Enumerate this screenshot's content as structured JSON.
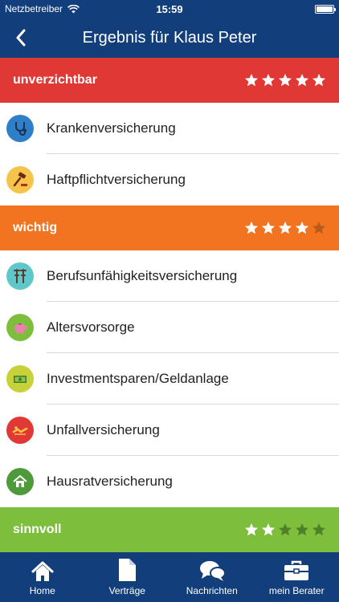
{
  "status_bar": {
    "carrier": "Netzbetreiber",
    "time": "15:59"
  },
  "nav": {
    "title": "Ergebnis für Klaus Peter"
  },
  "colors": {
    "nav": "#123e7c",
    "unverzichtbar": "#e03835",
    "wichtig": "#f27420",
    "sinnvoll": "#7dbf3c",
    "star_filled": "#ffffff"
  },
  "sections": [
    {
      "title": "unverzichtbar",
      "rating": 5,
      "items": [
        {
          "label": "Krankenversicherung",
          "icon": "stethoscope-icon"
        },
        {
          "label": "Haftpflichtversicherung",
          "icon": "gavel-icon"
        }
      ]
    },
    {
      "title": "wichtig",
      "rating": 4,
      "items": [
        {
          "label": "Berufsunfähigkeitsversicherung",
          "icon": "crutches-icon"
        },
        {
          "label": "Altersvorsorge",
          "icon": "piggy-bank-icon"
        },
        {
          "label": "Investmentsparen/Geldanlage",
          "icon": "banknote-icon"
        },
        {
          "label": "Unfallversicherung",
          "icon": "accident-icon"
        },
        {
          "label": "Hausratversicherung",
          "icon": "house-icon"
        }
      ]
    },
    {
      "title": "sinnvoll",
      "rating": 2,
      "items": []
    }
  ],
  "tabs": [
    {
      "label": "Home",
      "icon": "home-icon"
    },
    {
      "label": "Verträge",
      "icon": "document-icon"
    },
    {
      "label": "Nachrichten",
      "icon": "chat-bubbles-icon"
    },
    {
      "label": "mein Berater",
      "icon": "briefcase-icon"
    }
  ]
}
